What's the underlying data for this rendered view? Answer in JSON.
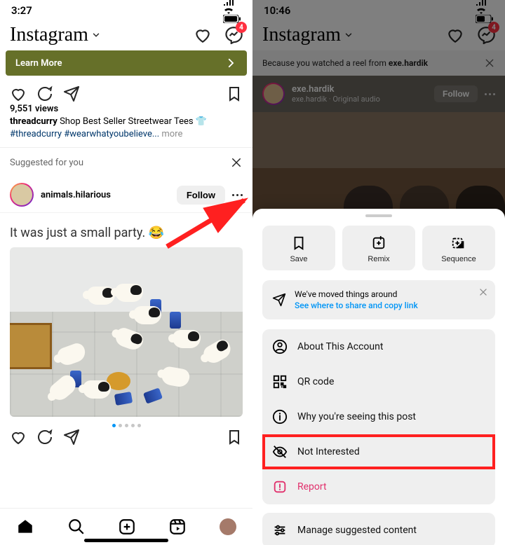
{
  "left": {
    "status": {
      "time": "3:27"
    },
    "header": {
      "brand": "Instagram",
      "badge": "4"
    },
    "banner": {
      "label": "Learn More"
    },
    "post1": {
      "views": "9,551 views",
      "caption_user": "threadcurry",
      "caption_text": " Shop Best Seller Streetwear Tees 👕",
      "hashtags": "#threadcurry #wearwhatyoubelieve...",
      "more": " more"
    },
    "suggested": {
      "title": "Suggested for you",
      "user": "animals.hilarious",
      "follow": "Follow"
    },
    "big_caption": "It was just a small party. 😂",
    "carousel": {
      "count": 5,
      "active": 0
    }
  },
  "right": {
    "status": {
      "time": "10:46"
    },
    "header": {
      "brand": "Instagram",
      "badge": "4"
    },
    "because": {
      "prefix": "Because you watched a reel from ",
      "user": "exe.hardik"
    },
    "suggested_post": {
      "user": "exe.hardik",
      "sub": "exe.hardik · Original audio",
      "follow": "Follow"
    },
    "sheet": {
      "top": [
        {
          "name": "save",
          "label": "Save"
        },
        {
          "name": "remix",
          "label": "Remix"
        },
        {
          "name": "sequence",
          "label": "Sequence"
        }
      ],
      "note": {
        "title": "We've moved things around",
        "link": "See where to share and copy link"
      },
      "items": [
        {
          "name": "about-account",
          "label": "About This Account"
        },
        {
          "name": "qr-code",
          "label": "QR code"
        },
        {
          "name": "why-seeing",
          "label": "Why you're seeing this post"
        },
        {
          "name": "not-interested",
          "label": "Not Interested",
          "highlight": true
        },
        {
          "name": "report",
          "label": "Report",
          "red": true
        }
      ],
      "manage": {
        "name": "manage-suggested",
        "label": "Manage suggested content"
      }
    }
  }
}
